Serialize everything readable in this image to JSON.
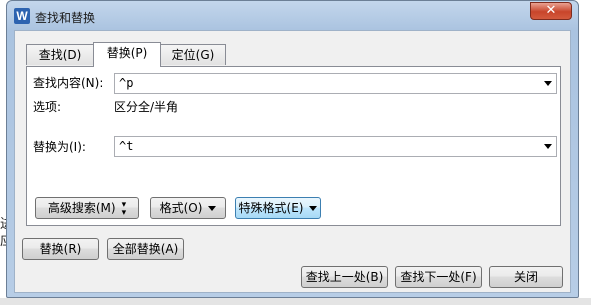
{
  "window": {
    "title": "查找和替换",
    "close_glyph": "✕",
    "app_icon_letter": "W"
  },
  "background": {
    "side_chars": [
      "进",
      "应"
    ]
  },
  "tabs": [
    {
      "label": "查找(D)"
    },
    {
      "label": "替换(P)"
    },
    {
      "label": "定位(G)"
    }
  ],
  "find": {
    "label": "查找内容(N):",
    "value": "^p"
  },
  "options": {
    "label": "选项:",
    "value": "区分全/半角"
  },
  "replace": {
    "label": "替换为(I):",
    "value": "^t"
  },
  "panel_buttons": {
    "advanced": "高级搜索(M)",
    "format": "格式(O)",
    "special": "特殊格式(E)"
  },
  "actions": {
    "replace": "替换(R)",
    "replace_all": "全部替换(A)",
    "find_prev": "查找上一处(B)",
    "find_next": "查找下一处(F)",
    "close": "关闭"
  }
}
